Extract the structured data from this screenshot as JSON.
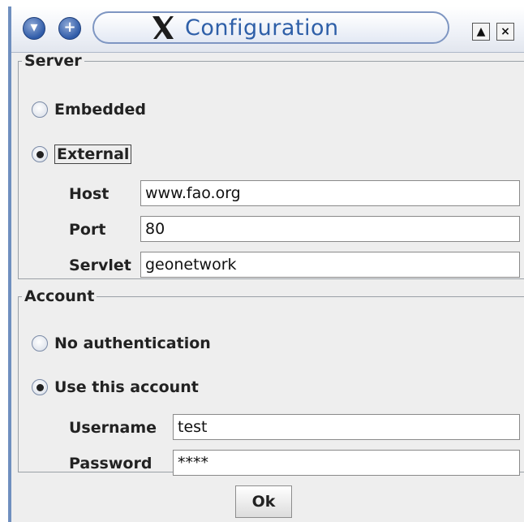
{
  "window": {
    "title": "Configuration",
    "menu_glyph": "▾",
    "add_glyph": "+",
    "shade_glyph": "▲",
    "close_glyph": "×"
  },
  "server": {
    "legend": "Server",
    "embedded_label": "Embedded",
    "external_label": "External",
    "selected": "External",
    "host_label": "Host",
    "host_value": "www.fao.org",
    "port_label": "Port",
    "port_value": "80",
    "servlet_label": "Servlet",
    "servlet_value": "geonetwork"
  },
  "account": {
    "legend": "Account",
    "no_auth_label": "No authentication",
    "use_account_label": "Use this account",
    "selected": "Use this account",
    "username_label": "Username",
    "username_value": "test",
    "password_label": "Password",
    "password_value": "****"
  },
  "footer": {
    "ok_label": "Ok"
  },
  "icons": {
    "menu": "menu-icon",
    "add": "add-icon",
    "app": "x-logo-icon",
    "shade": "shade-icon",
    "close": "close-icon"
  }
}
